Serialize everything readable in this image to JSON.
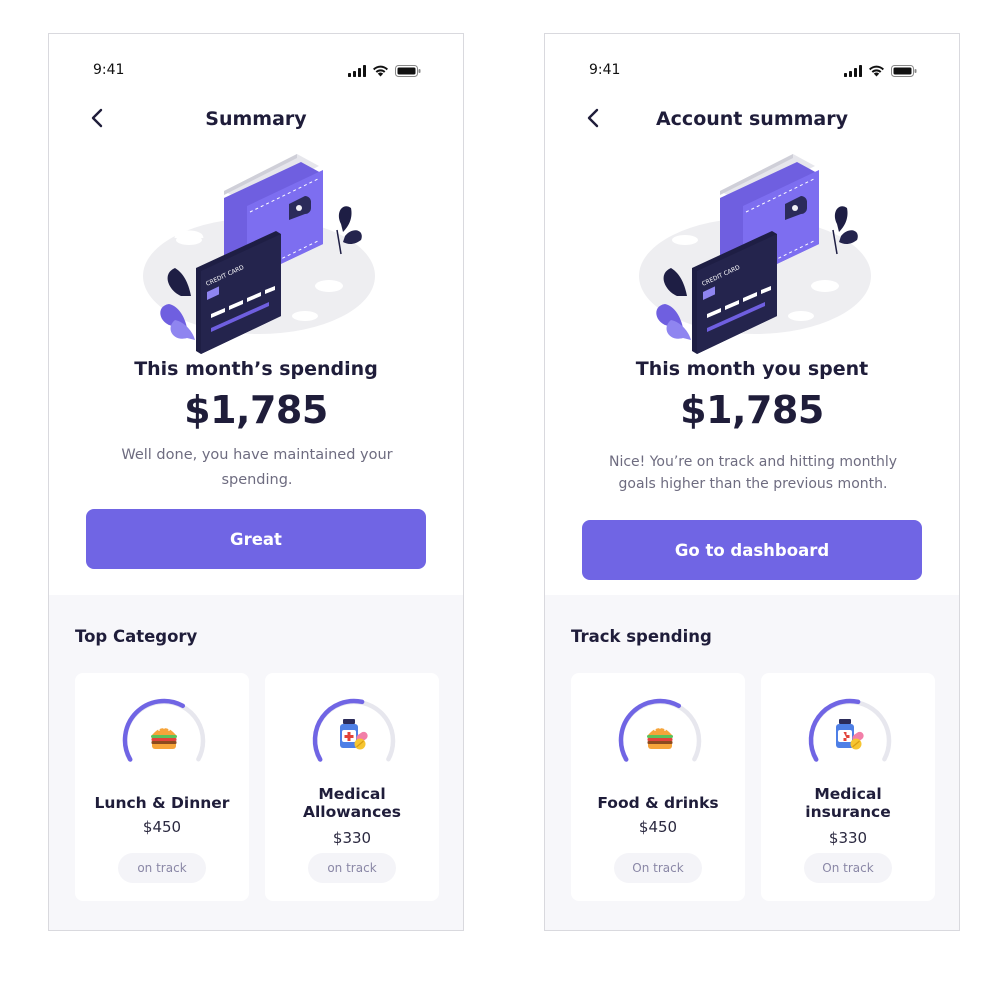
{
  "colors": {
    "accent": "#7065e4",
    "text_dark": "#1f1d3a",
    "text_muted": "#6e6c80",
    "section_bg": "#f7f7fa",
    "badge_text": "#8a87a6"
  },
  "screens": [
    {
      "status_bar": {
        "time": "9:41",
        "icons": [
          "signal-icon",
          "wifi-icon",
          "battery-icon"
        ]
      },
      "nav": {
        "back_icon": "chevron-left-icon",
        "title": "Summary"
      },
      "illustration": {
        "card_text": "CREDIT CARD"
      },
      "heading": "This month’s spending",
      "amount": "$1,785",
      "message": "Well done, you have maintained your spending.",
      "cta_label": "Great",
      "section_title": "Top Category",
      "categories": [
        {
          "name": "Lunch & Dinner",
          "amount": "$450",
          "status": "on track",
          "icon": "burger-icon",
          "progress": 0.62
        },
        {
          "name": "Medical Allowances",
          "amount": "$330",
          "status": "on track",
          "icon": "medicine-icon",
          "progress": 0.55
        }
      ]
    },
    {
      "status_bar": {
        "time": "9:41",
        "icons": [
          "signal-icon",
          "wifi-icon",
          "battery-icon"
        ]
      },
      "nav": {
        "back_icon": "chevron-left-icon",
        "title": "Account summary"
      },
      "illustration": {
        "card_text": "CREDIT CARD"
      },
      "heading": "This month you spent",
      "amount": "$1,785",
      "message": "Nice! You’re on track and hitting monthly goals higher than the previous month.",
      "cta_label": "Go to dashboard",
      "section_title": "Track spending",
      "categories": [
        {
          "name": "Food & drinks",
          "amount": "$450",
          "status": "On track",
          "icon": "burger-icon",
          "progress": 0.62
        },
        {
          "name": "Medical insurance",
          "amount": "$330",
          "status": "On track",
          "icon": "medicine-icon",
          "progress": 0.55
        }
      ]
    }
  ]
}
